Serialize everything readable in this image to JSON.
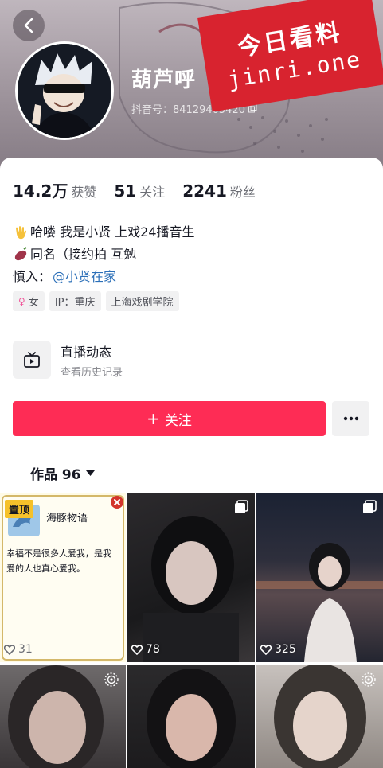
{
  "header": {
    "name": "葫芦呼",
    "douyin_id": "抖音号：84129405420",
    "watermark_cn": "今日看料",
    "watermark_en": "jinri.one"
  },
  "stats": [
    {
      "value": "14.2万",
      "label": "获赞"
    },
    {
      "value": "51",
      "label": "关注"
    },
    {
      "value": "2241",
      "label": "粉丝"
    }
  ],
  "bio": {
    "line1": "哈喽 我是小贤 上戏24播音生",
    "line2": "同名（接约拍 互勉",
    "line3_prefix": "慎入：",
    "line3_mention": "@小贤在家"
  },
  "tags": [
    "女",
    "IP：重庆",
    "上海戏剧学院"
  ],
  "live": {
    "title": "直播动态",
    "subtitle": "查看历史记录"
  },
  "follow_label": "关注",
  "works_tab": "作品 96",
  "posts": [
    {
      "likes": "31",
      "pinned_label": "置顶",
      "title": "海豚物语",
      "text": "幸福不是很多人爱我，是我爱的人也真心爱我。"
    },
    {
      "likes": "78"
    },
    {
      "likes": "325"
    },
    {
      "likes": ""
    },
    {
      "likes": ""
    },
    {
      "likes": ""
    }
  ],
  "colors": {
    "accent": "#fe2c55",
    "watermark": "#d8232f",
    "mention": "#2b6fb8"
  }
}
